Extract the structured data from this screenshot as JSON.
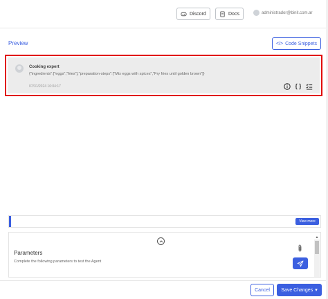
{
  "topbar": {
    "discord_label": "Discord",
    "docs_label": "Docs",
    "user_email": "administrador@binit.com.ar"
  },
  "preview": {
    "title": "Preview",
    "code_snippets_label": "Code Snippets"
  },
  "message": {
    "name": "Cooking expert",
    "body": "{\"ingredients\":[\"eggs\",\"fries\"],\"preparation-steps\":[\"Mix eggs with spices\",\"Fry fries until golden brown\"]}",
    "timestamp": "07/31/2024 16:04:17"
  },
  "view_more": {
    "label": "View more"
  },
  "parameters": {
    "title": "Parameters",
    "description": "Complete the following parameters to test the Agent"
  },
  "footer": {
    "cancel_label": "Cancel",
    "save_label": "Save Changes"
  },
  "colors": {
    "accent": "#3b5fe0",
    "highlight_border": "#e00000"
  }
}
